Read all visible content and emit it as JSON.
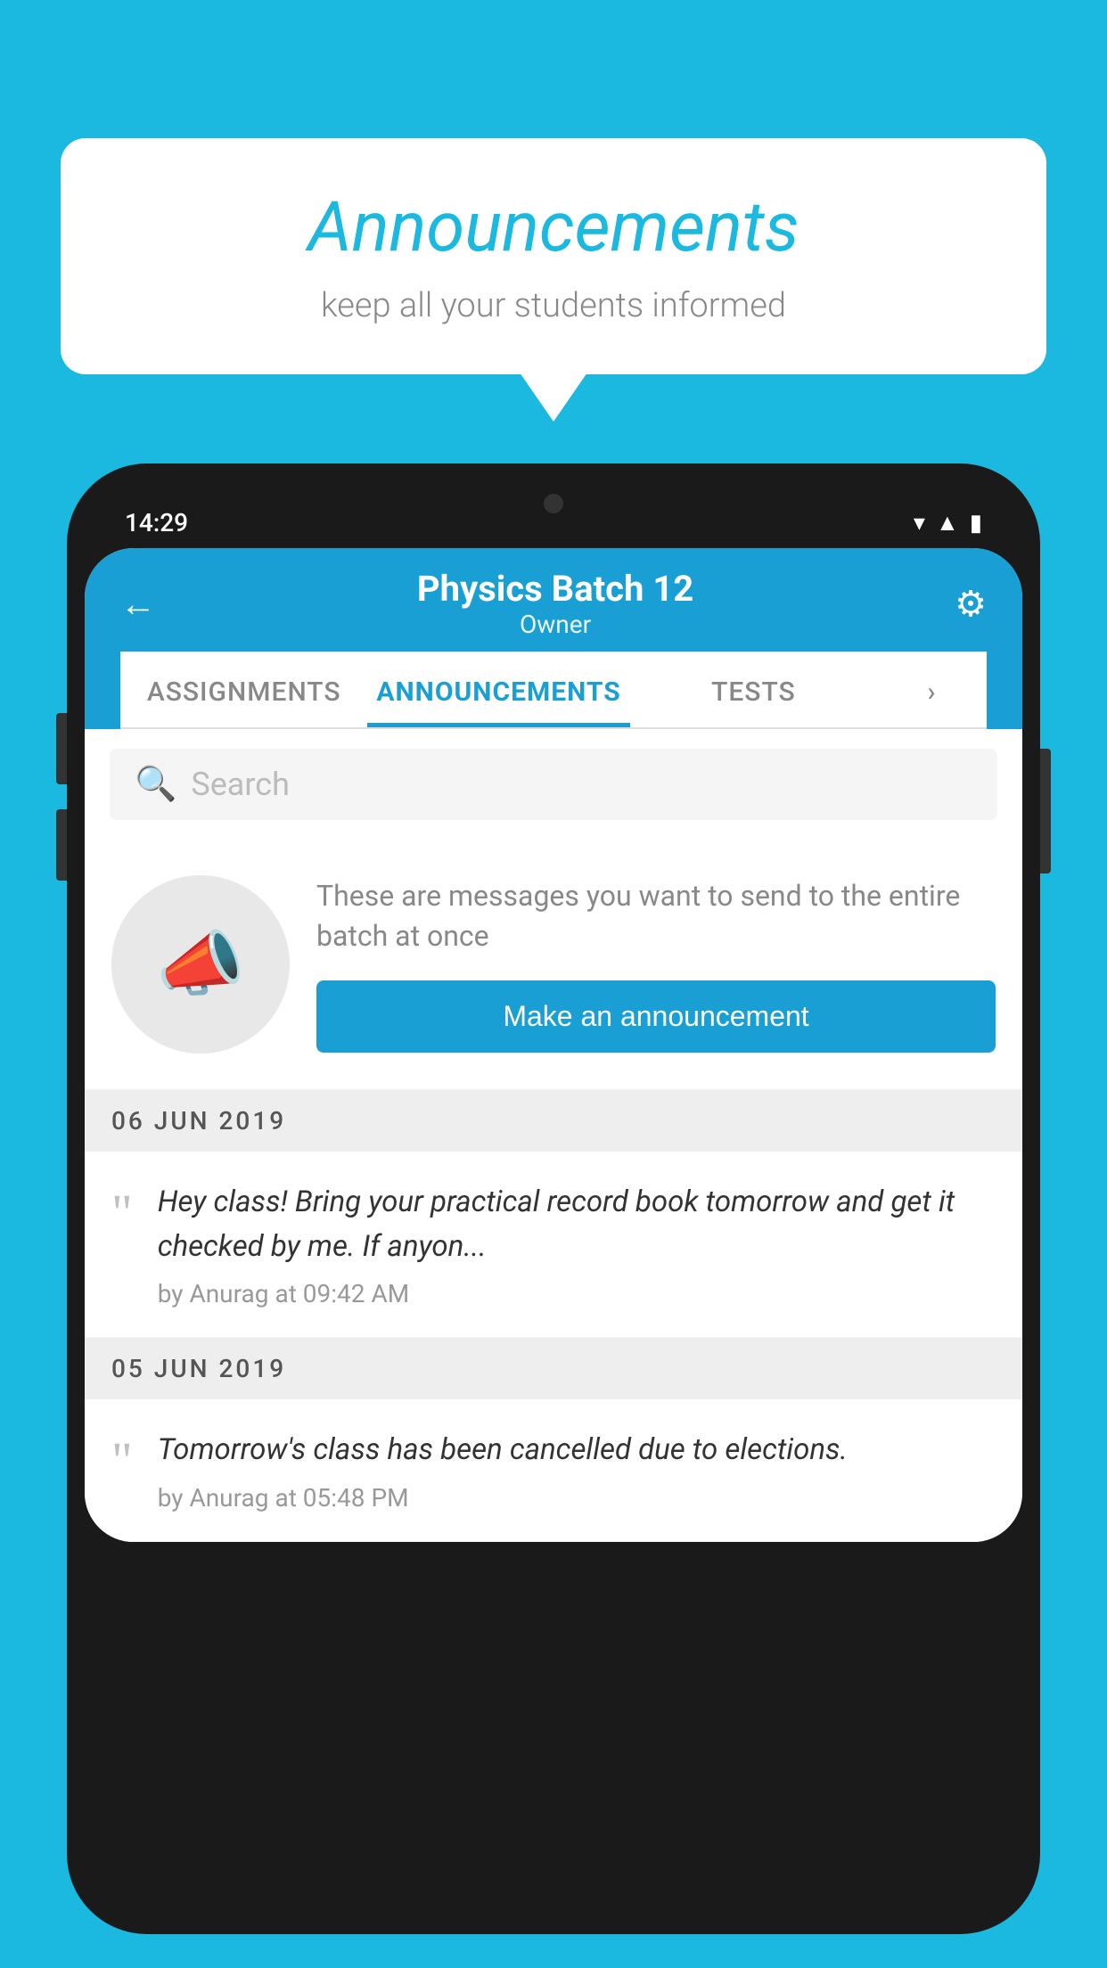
{
  "background_color": "#1bb8e0",
  "speech_bubble": {
    "title": "Announcements",
    "subtitle": "keep all your students informed"
  },
  "phone": {
    "status_bar": {
      "time": "14:29"
    },
    "header": {
      "title": "Physics Batch 12",
      "subtitle": "Owner",
      "back_label": "←",
      "gear_label": "⚙"
    },
    "tabs": [
      {
        "label": "ASSIGNMENTS",
        "active": false
      },
      {
        "label": "ANNOUNCEMENTS",
        "active": true
      },
      {
        "label": "TESTS",
        "active": false
      },
      {
        "label": "›",
        "active": false
      }
    ],
    "search": {
      "placeholder": "Search"
    },
    "promo": {
      "text": "These are messages you want to send to the entire batch at once",
      "button_label": "Make an announcement"
    },
    "announcements": [
      {
        "date_header": "06  JUN  2019",
        "text": "Hey class! Bring your practical record book tomorrow and get it checked by me. If anyon...",
        "meta": "by Anurag at 09:42 AM"
      },
      {
        "date_header": "05  JUN  2019",
        "text": "Tomorrow's class has been cancelled due to elections.",
        "meta": "by Anurag at 05:48 PM"
      }
    ]
  }
}
